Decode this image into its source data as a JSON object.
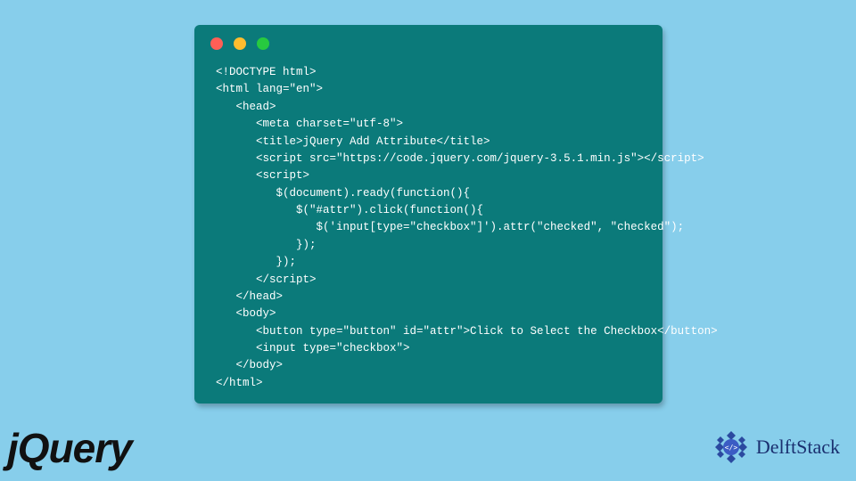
{
  "code_window": {
    "lines": [
      "<!DOCTYPE html>",
      "<html lang=\"en\">",
      "   <head>",
      "      <meta charset=\"utf-8\">",
      "      <title>jQuery Add Attribute</title>",
      "      <script src=\"https://code.jquery.com/jquery-3.5.1.min.js\"></script>",
      "      <script>",
      "         $(document).ready(function(){",
      "            $(\"#attr\").click(function(){",
      "               $('input[type=\"checkbox\"]').attr(\"checked\", \"checked\");",
      "            });",
      "         });",
      "      </script>",
      "   </head>",
      "   <body>",
      "      <button type=\"button\" id=\"attr\">Click to Select the Checkbox</button>",
      "      <input type=\"checkbox\">",
      "   </body>",
      "</html>"
    ]
  },
  "logos": {
    "jquery": "jQuery",
    "delftstack": "DelftStack"
  }
}
